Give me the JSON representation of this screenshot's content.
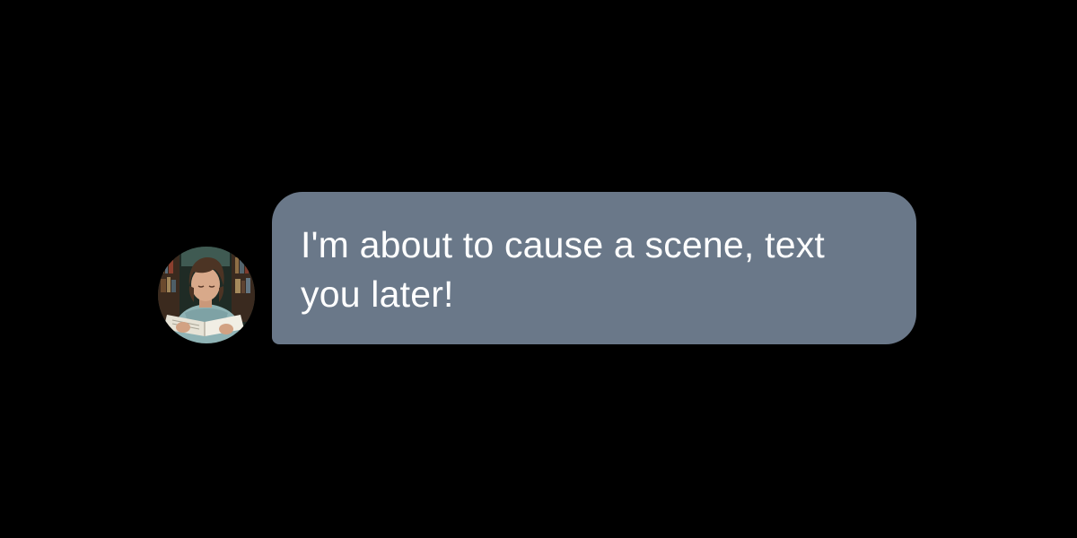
{
  "conversation": {
    "message": {
      "text": "I'm about to cause a scene, text you later!",
      "bubble_color": "#6a7889",
      "text_color": "#ffffff"
    },
    "avatar": {
      "icon": "person-reading-photo-icon"
    }
  },
  "colors": {
    "background": "#000000"
  }
}
